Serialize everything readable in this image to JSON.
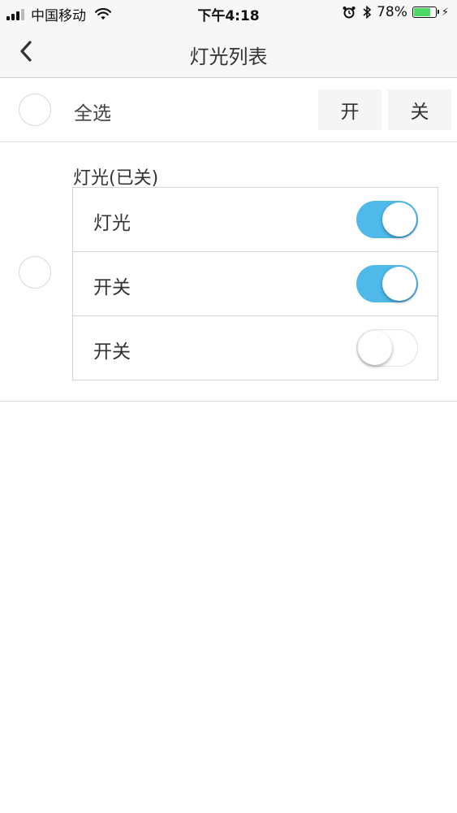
{
  "status_bar": {
    "carrier": "中国移动",
    "time": "下午4:18",
    "battery_pct": "78%",
    "battery_level": 0.78,
    "icons": [
      "signal-icon",
      "wifi-icon",
      "alarm-icon",
      "bluetooth-icon",
      "battery-icon",
      "charging-icon"
    ]
  },
  "nav": {
    "back_icon": "chevron-left-icon",
    "title": "灯光列表"
  },
  "select_all": {
    "label": "全选",
    "on_label": "开",
    "off_label": "关"
  },
  "group": {
    "title": "灯光(已关)",
    "switches": [
      {
        "label": "灯光",
        "on": true
      },
      {
        "label": "开关",
        "on": true
      },
      {
        "label": "开关",
        "on": false
      }
    ]
  },
  "colors": {
    "toggle_on": "#4fb9e9",
    "battery": "#4cd964"
  }
}
